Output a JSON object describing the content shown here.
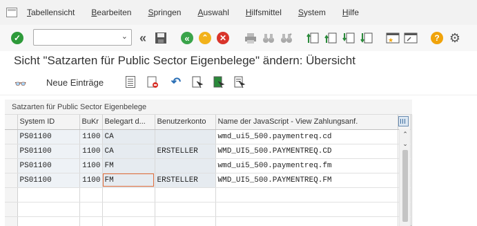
{
  "menu": {
    "items": [
      "Tabellensicht",
      "Bearbeiten",
      "Springen",
      "Auswahl",
      "Hilfsmittel",
      "System",
      "Hilfe"
    ],
    "underline": [
      "T",
      "B",
      "S",
      "A",
      "H",
      "S",
      "H"
    ]
  },
  "toolbar": {
    "command_field_value": "",
    "icons": [
      "enter-icon",
      "command-dropdown",
      "back-arrows-icon",
      "save-icon",
      "back-icon",
      "exit-icon",
      "cancel-icon",
      "print-icon",
      "find-icon",
      "find-next-icon",
      "first-page-icon",
      "previous-page-icon",
      "next-page-icon",
      "last-page-icon",
      "create-session-icon",
      "shortcut-icon",
      "help-icon",
      "customize-layout-icon"
    ]
  },
  "title": "Sicht \"Satzarten für Public Sector Eigenbelege\" ändern: Übersicht",
  "app_toolbar": {
    "new_entries_label": "Neue Einträge"
  },
  "table": {
    "title": "Satzarten für Public Sector Eigenbelege",
    "columns": [
      "System ID",
      "BuKr",
      "Belegart d...",
      "Benutzerkonto",
      "Name der JavaScript - View Zahlungsanf."
    ],
    "rows": [
      {
        "system_id": "PS01100",
        "bukr": "1100",
        "belegart": "CA",
        "benutzerkonto": "",
        "js_name": "wmd_ui5_500.paymentreq.cd"
      },
      {
        "system_id": "PS01100",
        "bukr": "1100",
        "belegart": "CA",
        "benutzerkonto": "ERSTELLER",
        "js_name": "WMD_UI5_500.PAYMENTREQ.CD"
      },
      {
        "system_id": "PS01100",
        "bukr": "1100",
        "belegart": "FM",
        "benutzerkonto": "",
        "js_name": "wmd_ui5_500.paymentreq.fm"
      },
      {
        "system_id": "PS01100",
        "bukr": "1100",
        "belegart": "FM",
        "benutzerkonto": "ERSTELLER",
        "js_name": "WMD_UI5_500.PAYMENTREQ.FM"
      }
    ]
  },
  "colors": {
    "enter_green": "#2e9a3a",
    "back_green": "#3aa44a",
    "exit_yellow": "#f2b21b",
    "cancel_red": "#d9342b",
    "help_orange": "#f0a30a",
    "focus_border": "#e06c3a"
  }
}
